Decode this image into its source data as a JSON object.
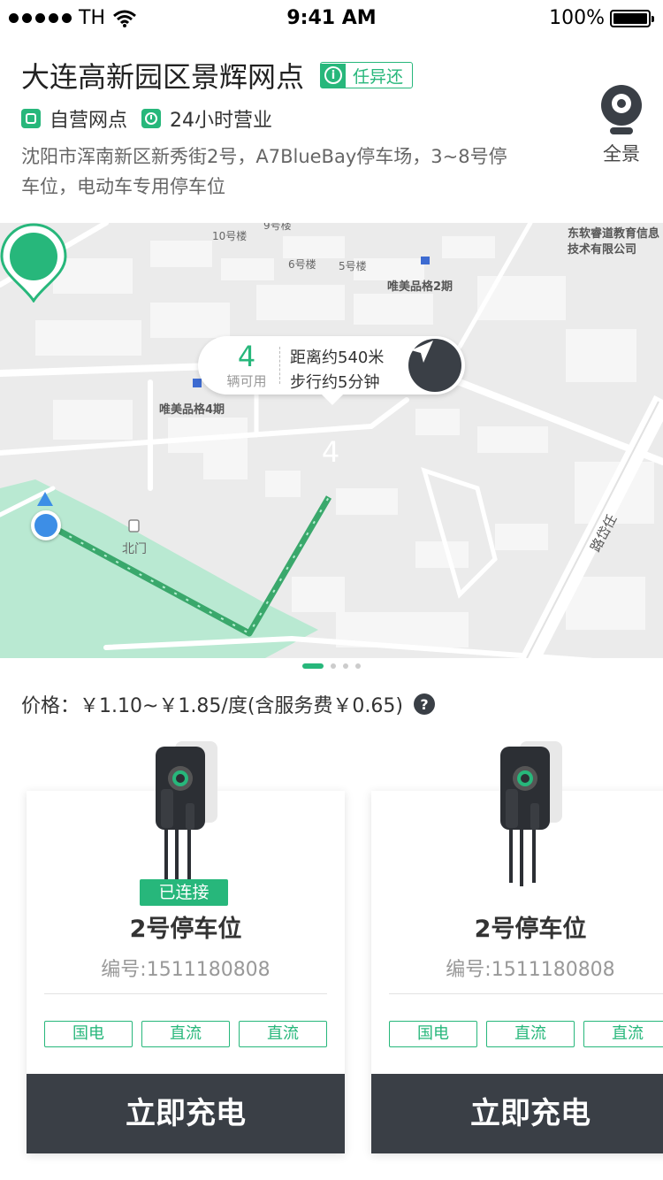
{
  "status_bar": {
    "carrier": "TH",
    "time": "9:41 AM",
    "battery": "100%"
  },
  "station": {
    "title": "大连高新园区景辉网点",
    "return_badge": "任异还",
    "tag_self": "自营网点",
    "tag_hours": "24小时营业",
    "address": "沈阳市浑南新区新秀街2号，A7BlueBay停车场，3~8号停车位，电动车专用停车位",
    "panorama_label": "全景"
  },
  "map": {
    "labels": {
      "building_9": "9号楼",
      "building_10": "10号楼",
      "building_6": "6号楼",
      "building_5": "5号楼",
      "weimei_2": "唯美品格2期",
      "weimei_4": "唯美品格4期",
      "neusoft": "东软睿道教育信息技术有限公司",
      "north_gate": "北门",
      "road": "路岱任"
    },
    "popup": {
      "count": "4",
      "available_label": "辆可用",
      "distance": "距离约540米",
      "walk": "步行约5分钟"
    },
    "pin_count": "4",
    "icons": {
      "navigate": "navigate-arrow-icon",
      "location": "my-location-icon"
    }
  },
  "pager": {
    "pages": 4,
    "active": 0
  },
  "price": {
    "label": "价格：",
    "text": "￥1.10~￥1.85/度(含服务费￥0.65)"
  },
  "cards": [
    {
      "status": "已连接",
      "name": "2号停车位",
      "code": "编号:1511180808",
      "chips": [
        "国电",
        "直流",
        "直流"
      ],
      "button": "立即充电"
    },
    {
      "name": "2号停车位",
      "code": "编号:1511180808",
      "chips": [
        "国电",
        "直流",
        "直流"
      ],
      "button": "立即充电"
    }
  ],
  "colors": {
    "accent": "#27b77b",
    "dark": "#3a3f46",
    "route": "#3aa86c",
    "park": "#b6e8cf",
    "location": "#3d8ee6"
  }
}
